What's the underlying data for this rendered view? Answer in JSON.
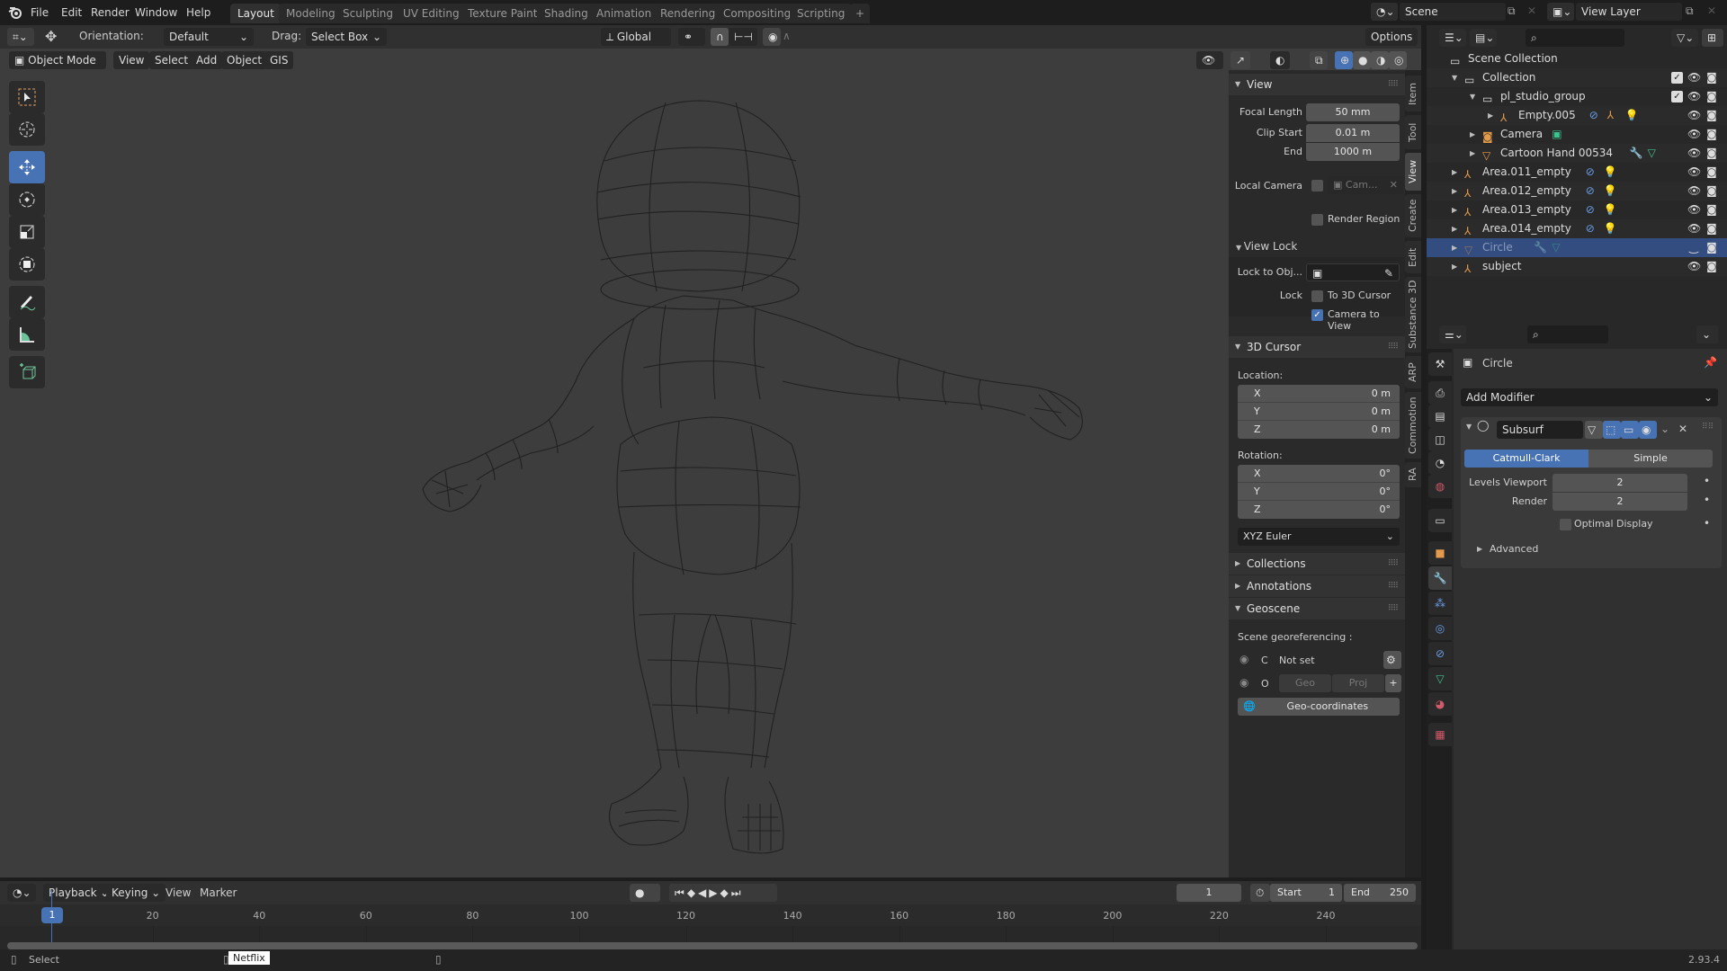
{
  "topbar": {
    "menus": [
      "File",
      "Edit",
      "Render",
      "Window",
      "Help"
    ],
    "workspaces": [
      "Layout",
      "Modeling",
      "Sculpting",
      "UV Editing",
      "Texture Paint",
      "Shading",
      "Animation",
      "Rendering",
      "Compositing",
      "Scripting"
    ],
    "active_workspace": "Layout",
    "add_workspace": "+",
    "scene": "Scene",
    "view_layer": "View Layer"
  },
  "tool_header": {
    "orientation_label": "Orientation:",
    "orientation_value": "Default",
    "drag_label": "Drag:",
    "drag_value": "Select Box",
    "transform_orientation": "Global",
    "options": "Options"
  },
  "viewport_header": {
    "mode": "Object Mode",
    "menus": [
      "View",
      "Select",
      "Add",
      "Object",
      "GIS"
    ]
  },
  "toolbar": [
    "select-box",
    "cursor",
    "move",
    "rotate",
    "scale",
    "transform",
    "annotate",
    "measure",
    "add-cube"
  ],
  "npanel": {
    "tabs": [
      "Item",
      "Tool",
      "View",
      "Create",
      "Edit",
      "Substance 3D",
      "ARP",
      "Commotion",
      "RA"
    ],
    "active_tab": "View",
    "view": {
      "title": "View",
      "focal_length_label": "Focal Length",
      "focal_length": "50 mm",
      "clip_start_label": "Clip Start",
      "clip_start": "0.01 m",
      "end_label": "End",
      "end": "1000 m",
      "local_camera_label": "Local Camera",
      "local_camera_value": "Cam...",
      "render_region_label": "Render Region"
    },
    "view_lock": {
      "title": "View Lock",
      "lock_to_obj_label": "Lock to Obj...",
      "lock_label": "Lock",
      "to_3d_cursor": "To 3D Cursor",
      "camera_to_view": "Camera to View",
      "camera_to_view_checked": true
    },
    "cursor": {
      "title": "3D Cursor",
      "location_label": "Location:",
      "location": [
        {
          "axis": "X",
          "value": "0 m"
        },
        {
          "axis": "Y",
          "value": "0 m"
        },
        {
          "axis": "Z",
          "value": "0 m"
        }
      ],
      "rotation_label": "Rotation:",
      "rotation": [
        {
          "axis": "X",
          "value": "0°"
        },
        {
          "axis": "Y",
          "value": "0°"
        },
        {
          "axis": "Z",
          "value": "0°"
        }
      ],
      "rotation_mode": "XYZ Euler"
    },
    "collapsed": [
      "Collections",
      "Annotations"
    ],
    "geoscene": {
      "title": "Geoscene",
      "georef_label": "Scene georeferencing :",
      "c_label": "C",
      "c_value": "Not set",
      "o_label": "O",
      "geo": "Geo",
      "proj": "Proj",
      "plus": "+",
      "geo_coords": "Geo-coordinates"
    }
  },
  "outliner": {
    "root": "Scene Collection",
    "rows": [
      {
        "name": "Collection",
        "depth": 0,
        "type": "collection",
        "expanded": true,
        "check": true
      },
      {
        "name": "pl_studio_group",
        "depth": 1,
        "type": "collection",
        "expanded": true,
        "check": true
      },
      {
        "name": "Empty.005",
        "depth": 2,
        "type": "empty",
        "expanded": false,
        "badges": [
          "constraint",
          "empty-4",
          "light-4"
        ]
      },
      {
        "name": "Camera",
        "depth": 1,
        "type": "camera",
        "expanded": false,
        "badges": [
          "camera-data"
        ]
      },
      {
        "name": "Cartoon Hand 00534",
        "depth": 1,
        "type": "mesh",
        "expanded": false,
        "badges": [
          "modifier",
          "mesh-data"
        ]
      },
      {
        "name": "Area.011_empty",
        "depth": 0,
        "type": "empty",
        "expanded": false,
        "badges": [
          "constraint",
          "light"
        ]
      },
      {
        "name": "Area.012_empty",
        "depth": 0,
        "type": "empty",
        "expanded": false,
        "badges": [
          "constraint",
          "light"
        ]
      },
      {
        "name": "Area.013_empty",
        "depth": 0,
        "type": "empty",
        "expanded": false,
        "badges": [
          "constraint",
          "light"
        ]
      },
      {
        "name": "Area.014_empty",
        "depth": 0,
        "type": "empty",
        "expanded": false,
        "badges": [
          "constraint",
          "light"
        ]
      },
      {
        "name": "Circle",
        "depth": 0,
        "type": "mesh",
        "expanded": false,
        "selected": true,
        "hidden": true,
        "badges": [
          "modifier",
          "mesh-data"
        ]
      },
      {
        "name": "subject",
        "depth": 0,
        "type": "empty",
        "expanded": false,
        "badges": []
      }
    ]
  },
  "properties": {
    "object_name": "Circle",
    "add_modifier": "Add Modifier",
    "modifier": {
      "name": "Subsurf",
      "catmull": "Catmull-Clark",
      "simple": "Simple",
      "levels_viewport_label": "Levels Viewport",
      "levels_viewport": "2",
      "render_label": "Render",
      "render": "2",
      "optimal_display": "Optimal Display",
      "advanced": "Advanced"
    }
  },
  "timeline": {
    "menus": [
      "Playback",
      "Keying",
      "View",
      "Marker"
    ],
    "current_frame": "1",
    "start_label": "Start",
    "start": "1",
    "end_label": "End",
    "end": "250",
    "ticks": [
      "20",
      "40",
      "60",
      "80",
      "100",
      "120",
      "140",
      "160",
      "180",
      "200",
      "220",
      "240"
    ],
    "playhead": "1"
  },
  "status": {
    "select": "Select",
    "tooltip": "Netflix",
    "version": "2.93.4"
  },
  "colors": {
    "accent": "#4772b3",
    "selected_row": "#334d80",
    "object_orange": "#e39a4c",
    "mesh_green": "#3ec38f"
  }
}
